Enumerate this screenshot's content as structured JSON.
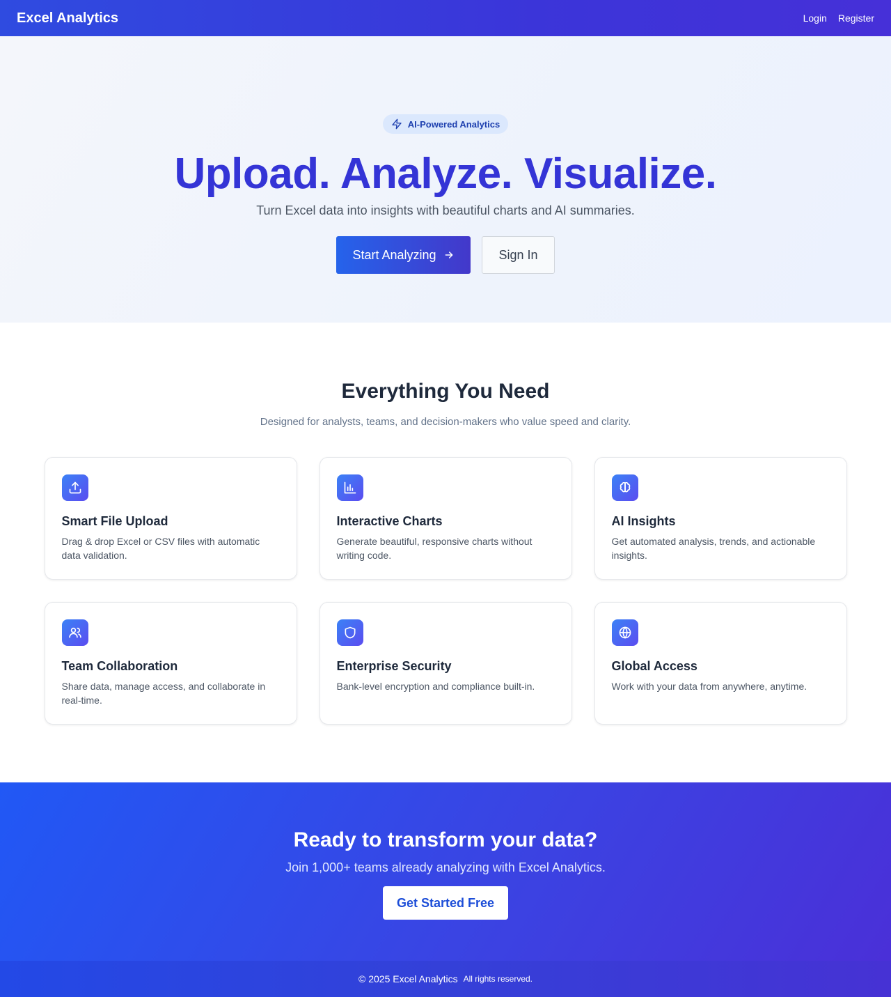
{
  "navbar": {
    "brand": "Excel Analytics",
    "links": [
      {
        "label": "Login"
      },
      {
        "label": "Register"
      }
    ]
  },
  "hero": {
    "badge": "AI-Powered Analytics",
    "badge_icon": "lightning-icon",
    "title": "Upload. Analyze. Visualize.",
    "subtitle": "Turn Excel data into insights with beautiful charts and AI summaries.",
    "primary_button": "Start Analyzing",
    "primary_button_icon": "arrow-right-icon",
    "secondary_button": "Sign In"
  },
  "features": {
    "title": "Everything You Need",
    "subtitle": "Designed for analysts, teams, and decision-makers who value speed and clarity.",
    "cards": [
      {
        "icon": "upload-icon",
        "title": "Smart File Upload",
        "desc": "Drag & drop Excel or CSV files with automatic data validation."
      },
      {
        "icon": "bar-chart-icon",
        "title": "Interactive Charts",
        "desc": "Generate beautiful, responsive charts without writing code."
      },
      {
        "icon": "brain-icon",
        "title": "AI Insights",
        "desc": "Get automated analysis, trends, and actionable insights."
      },
      {
        "icon": "users-icon",
        "title": "Team Collaboration",
        "desc": "Share data, manage access, and collaborate in real-time."
      },
      {
        "icon": "shield-icon",
        "title": "Enterprise Security",
        "desc": "Bank-level encryption and compliance built-in."
      },
      {
        "icon": "globe-icon",
        "title": "Global Access",
        "desc": "Work with your data from anywhere, anytime."
      }
    ]
  },
  "cta": {
    "title": "Ready to transform your data?",
    "subtitle": "Join 1,000+ teams already analyzing with Excel Analytics.",
    "button": "Get Started Free"
  },
  "footer": {
    "copyright": "© 2025 Excel Analytics",
    "rights": "All rights reserved."
  },
  "colors": {
    "brand_primary": "#2563eb",
    "brand_secondary": "#4338ca",
    "hero_title": "#3434d6",
    "badge_bg": "#dbe8fd"
  }
}
